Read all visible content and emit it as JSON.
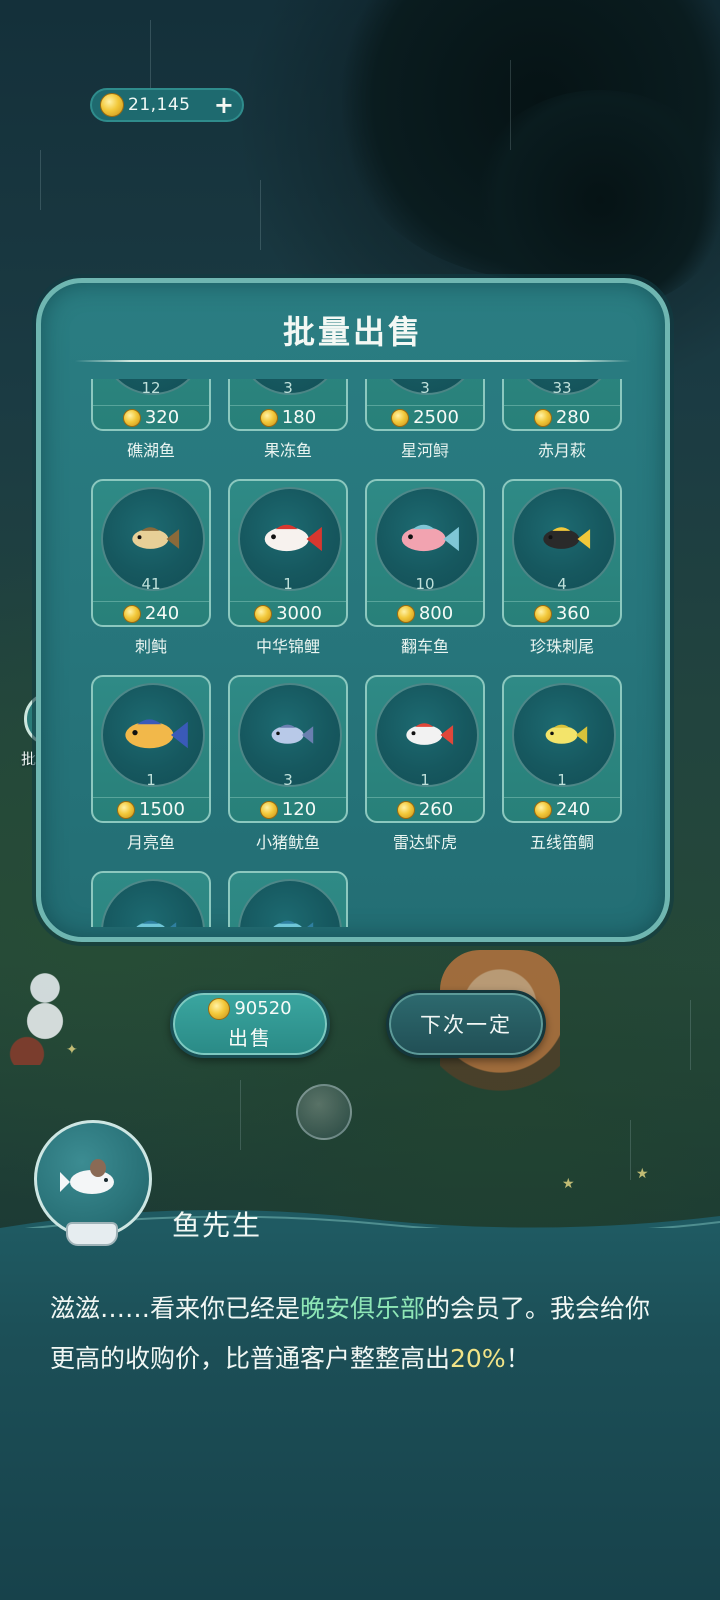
{
  "top_bar": {
    "coin_balance": "21,145",
    "plus_label": "+"
  },
  "side_button": {
    "label": "批量出售",
    "icon": "basket-icon"
  },
  "panel": {
    "title": "批量出售",
    "fish": [
      {
        "name": "礁湖鱼",
        "count": "12",
        "price": "320",
        "icon": "lagoon-fish-icon"
      },
      {
        "name": "果冻鱼",
        "count": "3",
        "price": "180",
        "icon": "jelly-fish-icon"
      },
      {
        "name": "星河鲟",
        "count": "3",
        "price": "2500",
        "icon": "galaxy-sturgeon-icon"
      },
      {
        "name": "赤月萩",
        "count": "33",
        "price": "280",
        "icon": "red-moon-fish-icon"
      },
      {
        "name": "刺鲀",
        "count": "41",
        "price": "240",
        "icon": "pufferfish-icon"
      },
      {
        "name": "中华锦鲤",
        "count": "1",
        "price": "3000",
        "icon": "koi-icon"
      },
      {
        "name": "翻车鱼",
        "count": "10",
        "price": "800",
        "icon": "sunfish-icon"
      },
      {
        "name": "珍珠刺尾",
        "count": "4",
        "price": "360",
        "icon": "pearl-tang-icon"
      },
      {
        "name": "月亮鱼",
        "count": "1",
        "price": "1500",
        "icon": "opah-icon"
      },
      {
        "name": "小猪鱿鱼",
        "count": "3",
        "price": "120",
        "icon": "piglet-squid-icon"
      },
      {
        "name": "雷达虾虎",
        "count": "1",
        "price": "260",
        "icon": "radar-goby-icon"
      },
      {
        "name": "五线笛鲷",
        "count": "1",
        "price": "240",
        "icon": "fiveline-snapper-icon"
      },
      {
        "name": "",
        "count": "",
        "price": "",
        "icon": "partial-fish-icon"
      },
      {
        "name": "",
        "count": "",
        "price": "",
        "icon": "partial-fish-icon"
      }
    ]
  },
  "actions": {
    "sell_total": "90520",
    "sell_label": "出售",
    "next_label": "下次一定"
  },
  "dialog": {
    "speaker": "鱼先生",
    "text_part1": "滋滋……看来你已经是",
    "club_name": "晚安俱乐部",
    "text_part2": "的会员了。我会给你更高的收购价，比普通客户整整高出",
    "percent": "20%",
    "text_end": "！"
  },
  "colors": {
    "panel_bg": "#2a7d82",
    "highlight_green": "#8ee6b6",
    "highlight_yellow": "#f1e387",
    "coin_gold": "#f2c83a"
  }
}
